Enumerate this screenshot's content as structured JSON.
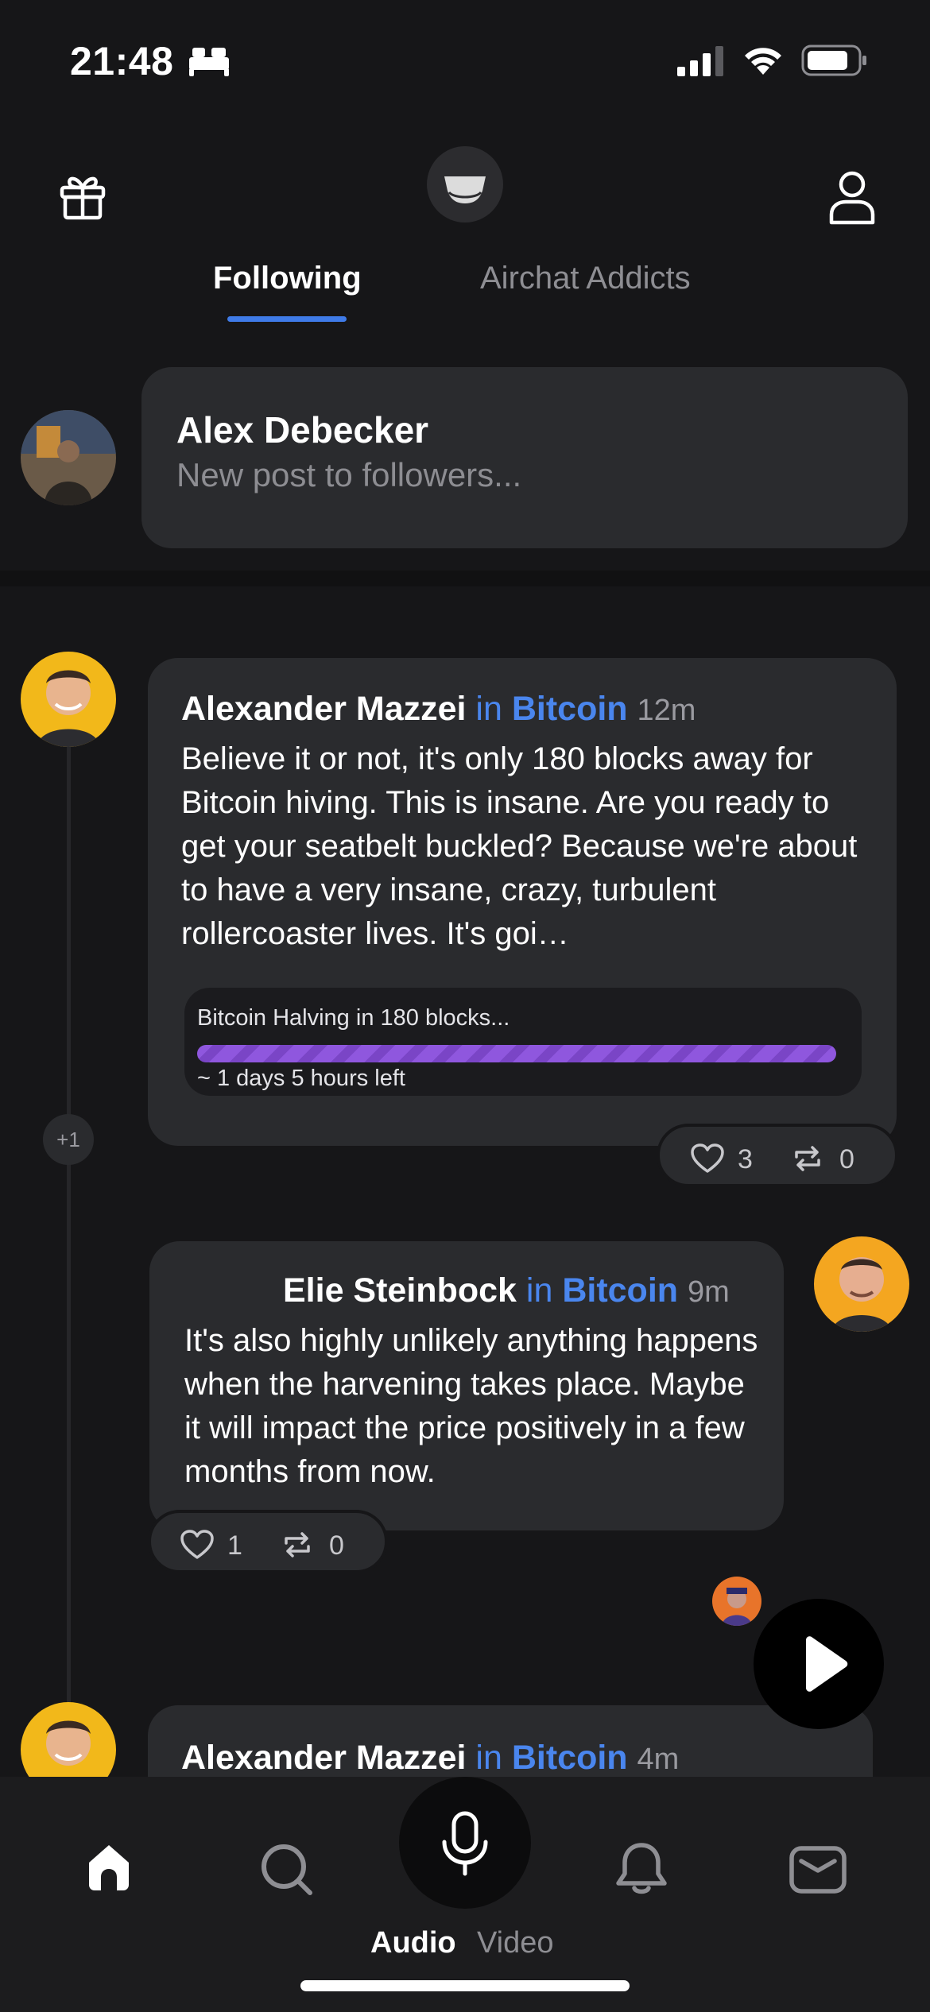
{
  "status_bar": {
    "time": "21:48",
    "focus_icon": "bed-icon",
    "signal_icon": "cellular-signal-icon",
    "wifi_icon": "wifi-icon",
    "battery_icon": "battery-icon"
  },
  "header": {
    "left_icon": "gift-icon",
    "logo_icon": "airchat-logo-icon",
    "right_icon": "profile-icon",
    "tabs": [
      {
        "label": "Following",
        "active": true
      },
      {
        "label": "Airchat Addicts",
        "active": false
      }
    ]
  },
  "compose": {
    "name": "Alex Debecker",
    "placeholder": "New post to followers..."
  },
  "feed": {
    "posts": [
      {
        "author": "Alexander Mazzei",
        "in_label": "in",
        "channel": "Bitcoin",
        "time": "12m",
        "body": "Believe it or not, it's only 180 blocks away for Bitcoin hiving. This is insane. Are you ready to get your seatbelt buckled? Because we're about to have a very insane, crazy, turbulent rollercoaster lives. It's goi…",
        "widget": {
          "title": "Bitcoin Halving in 180 blocks...",
          "subtitle": "~ 1 days 5 hours left",
          "progress": 0.99
        },
        "likes": "3",
        "reposts": "0"
      },
      {
        "author": "Elie Steinbock",
        "in_label": "in",
        "channel": "Bitcoin",
        "time": "9m",
        "body": "It's also highly unlikely anything happens when the harvening takes place. Maybe it will impact the price positively in a few months from now.",
        "likes": "1",
        "reposts": "0"
      },
      {
        "author": "Alexander Mazzei",
        "in_label": "in",
        "channel": "Bitcoin",
        "time": "4m"
      }
    ],
    "thread_badge": "+1",
    "play_icon": "play-icon"
  },
  "bottom_nav": {
    "items": [
      "home-icon",
      "search-icon",
      "microphone-icon",
      "bell-icon",
      "inbox-icon"
    ],
    "mode_audio": "Audio",
    "mode_video": "Video"
  },
  "colors": {
    "background": "#161618",
    "card": "#2a2b2e",
    "accent_blue": "#4a86ee",
    "tab_underline": "#3f7be8",
    "progress_purple": "#8f57de"
  }
}
